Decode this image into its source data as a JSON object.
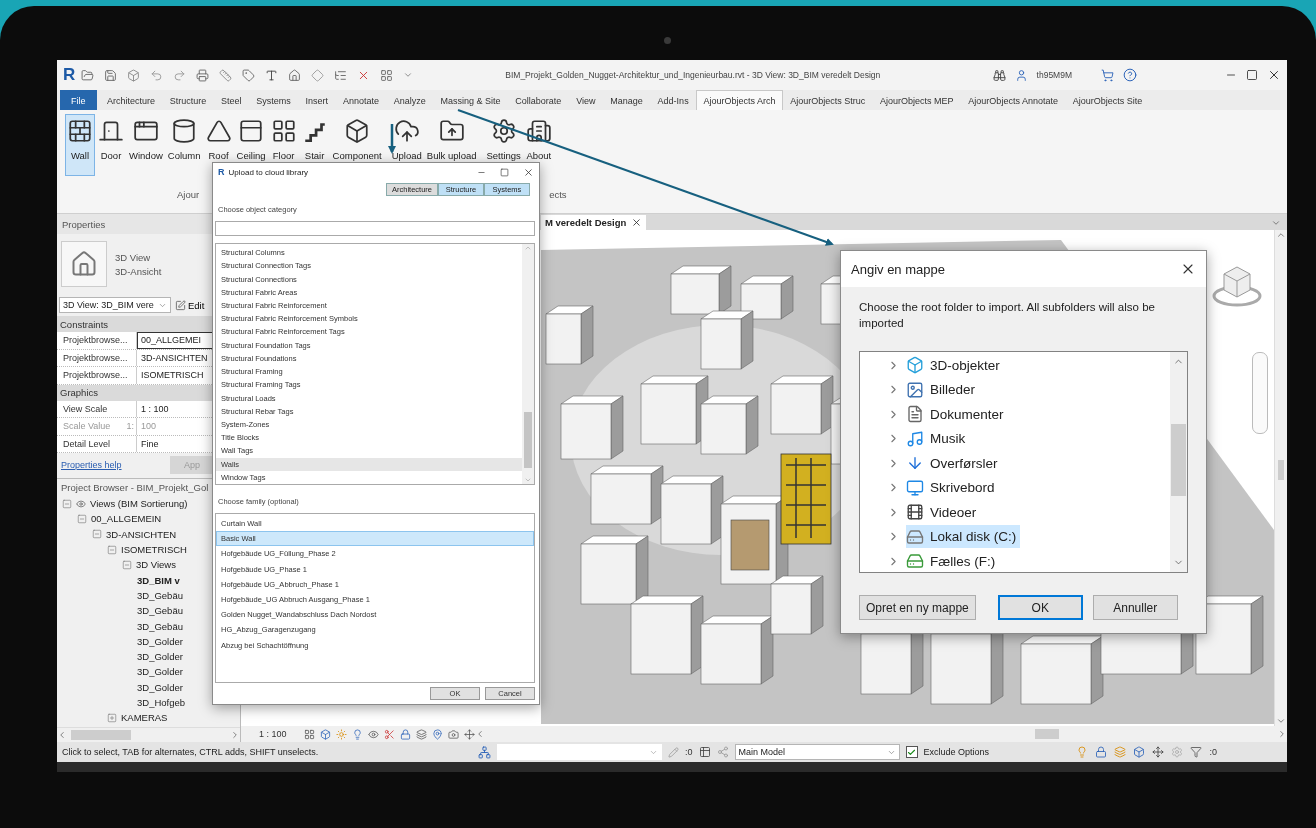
{
  "revit": {
    "app_logo": "R",
    "title": "BIM_Projekt_Golden_Nugget-Architektur_und_Ingenieurbau.rvt - 3D View: 3D_BIM veredelt Design",
    "user": "th95M9M",
    "ribbon_tabs": [
      {
        "label": "File",
        "kind": "file",
        "selected": false
      },
      {
        "label": "Architecture",
        "kind": "tab",
        "selected": false
      },
      {
        "label": "Structure",
        "kind": "tab",
        "selected": false
      },
      {
        "label": "Steel",
        "kind": "tab",
        "selected": false
      },
      {
        "label": "Systems",
        "kind": "tab",
        "selected": false
      },
      {
        "label": "Insert",
        "kind": "tab",
        "selected": false
      },
      {
        "label": "Annotate",
        "kind": "tab",
        "selected": false
      },
      {
        "label": "Analyze",
        "kind": "tab",
        "selected": false
      },
      {
        "label": "Massing & Site",
        "kind": "tab",
        "selected": false
      },
      {
        "label": "Collaborate",
        "kind": "tab",
        "selected": false
      },
      {
        "label": "View",
        "kind": "tab",
        "selected": false
      },
      {
        "label": "Manage",
        "kind": "tab",
        "selected": false
      },
      {
        "label": "Add-Ins",
        "kind": "tab",
        "selected": false
      },
      {
        "label": "AjourObjects Arch",
        "kind": "tab",
        "selected": true
      },
      {
        "label": "AjourObjects Struc",
        "kind": "tab",
        "selected": false
      },
      {
        "label": "AjourObjects MEP",
        "kind": "tab",
        "selected": false
      },
      {
        "label": "AjourObjects Annotate",
        "kind": "tab",
        "selected": false
      },
      {
        "label": "AjourObjects Site",
        "kind": "tab",
        "selected": false
      }
    ],
    "ribbon_buttons": [
      {
        "label": "Wall",
        "selected": true
      },
      {
        "label": "Door",
        "selected": false
      },
      {
        "label": "Window",
        "selected": false
      },
      {
        "label": "Column",
        "selected": false
      },
      {
        "label": "Roof",
        "selected": false
      },
      {
        "label": "Ceiling",
        "selected": false
      },
      {
        "label": "Floor",
        "selected": false
      },
      {
        "label": "Stair",
        "selected": false
      },
      {
        "label": "Component",
        "selected": false
      },
      {
        "label": "Upload",
        "selected": false
      },
      {
        "label": "Bulk upload",
        "selected": false
      },
      {
        "label": "Settings",
        "selected": false
      },
      {
        "label": "About",
        "selected": false
      }
    ],
    "panel_labels": [
      "Ajour",
      "ects"
    ],
    "properties": {
      "title": "Properties",
      "type_lines": [
        "3D View",
        "3D-Ansicht"
      ],
      "view_selector": "3D View: 3D_BIM vere",
      "edit_button": "Edit",
      "sections": [
        {
          "title": "Constraints",
          "rows": [
            {
              "name": "Projektbrowse...",
              "value": "00_ALLGEMEI",
              "editing": true,
              "disabled": false
            },
            {
              "name": "Projektbrowse...",
              "value": "3D-ANSICHTEN",
              "editing": false,
              "disabled": false
            },
            {
              "name": "Projektbrowse...",
              "value": "ISOMETRISCH",
              "editing": false,
              "disabled": false
            }
          ]
        },
        {
          "title": "Graphics",
          "rows": [
            {
              "name": "View Scale",
              "value": "1 : 100",
              "editing": false,
              "disabled": false
            },
            {
              "name": "Scale Value",
              "unit": "1:",
              "value": "100",
              "editing": false,
              "disabled": true
            },
            {
              "name": "Detail Level",
              "value": "Fine",
              "editing": false,
              "disabled": false
            }
          ]
        }
      ],
      "help_link": "Properties help",
      "apply_button": "App"
    },
    "browser": {
      "title": "Project Browser - BIM_Projekt_Gol",
      "tree": [
        {
          "label": "Views (BIM Sortierung)",
          "kind": "views",
          "expanded": true,
          "children": [
            {
              "label": "00_ALLGEMEIN",
              "kind": "group",
              "expanded": true,
              "children": [
                {
                  "label": "3D-ANSICHTEN",
                  "kind": "group",
                  "expanded": true,
                  "children": [
                    {
                      "label": "ISOMETRISCH",
                      "kind": "group",
                      "expanded": true,
                      "children": [
                        {
                          "label": "3D Views",
                          "kind": "group",
                          "expanded": true,
                          "children": [
                            {
                              "label": "3D_BIM v",
                              "kind": "view",
                              "active": true
                            },
                            {
                              "label": "3D_Gebäu",
                              "kind": "view",
                              "active": false
                            },
                            {
                              "label": "3D_Gebäu",
                              "kind": "view",
                              "active": false
                            },
                            {
                              "label": "3D_Gebäu",
                              "kind": "view",
                              "active": false
                            },
                            {
                              "label": "3D_Golder",
                              "kind": "view",
                              "active": false
                            },
                            {
                              "label": "3D_Golder",
                              "kind": "view",
                              "active": false
                            },
                            {
                              "label": "3D_Golder",
                              "kind": "view",
                              "active": false
                            },
                            {
                              "label": "3D_Golder",
                              "kind": "view",
                              "active": false
                            },
                            {
                              "label": "3D_Hofgeb",
                              "kind": "view",
                              "active": false
                            }
                          ]
                        }
                      ]
                    },
                    {
                      "label": "KAMERAS",
                      "kind": "group",
                      "expanded": false
                    }
                  ]
                }
              ]
            }
          ]
        }
      ]
    },
    "view_tab": "M veredelt Design",
    "view_scale": "1 : 100",
    "status": {
      "text": "Click to select, TAB for alternates, CTRL adds, SHIFT unselects.",
      "selection_count": ":0",
      "workset": "Main Model",
      "exclude_options": {
        "label": "Exclude Options",
        "checked": true
      },
      "filter_count": ":0"
    }
  },
  "upload_dialog": {
    "icon_letter": "R",
    "title": "Upload to cloud library",
    "tabs": [
      {
        "label": "Architecture",
        "selected": true
      },
      {
        "label": "Structure",
        "selected": false
      },
      {
        "label": "Systems",
        "selected": false
      }
    ],
    "category_label": "Choose object category",
    "categories": [
      {
        "label": "Structural Columns",
        "selected": false
      },
      {
        "label": "Structural Connection Tags",
        "selected": false
      },
      {
        "label": "Structural Connections",
        "selected": false
      },
      {
        "label": "Structural Fabric Areas",
        "selected": false
      },
      {
        "label": "Structural Fabric Reinforcement",
        "selected": false
      },
      {
        "label": "Structural Fabric Reinforcement Symbols",
        "selected": false
      },
      {
        "label": "Structural Fabric Reinforcement Tags",
        "selected": false
      },
      {
        "label": "Structural Foundation Tags",
        "selected": false
      },
      {
        "label": "Structural Foundations",
        "selected": false
      },
      {
        "label": "Structural Framing",
        "selected": false
      },
      {
        "label": "Structural Framing Tags",
        "selected": false
      },
      {
        "label": "Structural Loads",
        "selected": false
      },
      {
        "label": "Structural Rebar Tags",
        "selected": false
      },
      {
        "label": "System-Zones",
        "selected": false
      },
      {
        "label": "Title Blocks",
        "selected": false
      },
      {
        "label": "Wall Tags",
        "selected": false
      },
      {
        "label": "Walls",
        "selected": true
      },
      {
        "label": "Window Tags",
        "selected": false
      }
    ],
    "family_label": "Choose family (optional)",
    "families": [
      {
        "label": "Curtain Wall",
        "selected": false
      },
      {
        "label": "Basic Wall",
        "selected": true
      },
      {
        "label": "Hofgebäude UG_Füllung_Phase 2",
        "selected": false
      },
      {
        "label": "Hofgebäude UG_Phase 1",
        "selected": false
      },
      {
        "label": "Hofgebäude UG_Abbruch_Phase 1",
        "selected": false
      },
      {
        "label": "Hofgebäude_UG Abbruch Ausgang_Phase 1",
        "selected": false
      },
      {
        "label": "Golden Nugget_Wandabschluss Dach Nordost",
        "selected": false
      },
      {
        "label": "HG_Abzug_Garagenzugang",
        "selected": false
      },
      {
        "label": "Abzug bei Schachtöffnung",
        "selected": false
      }
    ],
    "buttons": [
      "OK",
      "Cancel"
    ]
  },
  "folder_dialog": {
    "title": "Angiv en mappe",
    "message": "Choose the root folder to import. All subfolders will also be imported",
    "folders": [
      {
        "label": "3D-objekter",
        "expanded": false,
        "selected": false
      },
      {
        "label": "Billeder",
        "expanded": false,
        "selected": false
      },
      {
        "label": "Dokumenter",
        "expanded": false,
        "selected": false
      },
      {
        "label": "Musik",
        "expanded": false,
        "selected": false
      },
      {
        "label": "Overførsler",
        "expanded": false,
        "selected": false
      },
      {
        "label": "Skrivebord",
        "expanded": false,
        "selected": false
      },
      {
        "label": "Videoer",
        "expanded": false,
        "selected": false
      },
      {
        "label": "Lokal disk (C:)",
        "expanded": false,
        "selected": true
      },
      {
        "label": "Fælles (F:)",
        "expanded": false,
        "selected": false
      }
    ],
    "buttons": [
      {
        "label": "Opret en ny mappe",
        "kind": "secondary"
      },
      {
        "label": "OK",
        "kind": "default"
      },
      {
        "label": "Annuller",
        "kind": "secondary"
      }
    ]
  }
}
